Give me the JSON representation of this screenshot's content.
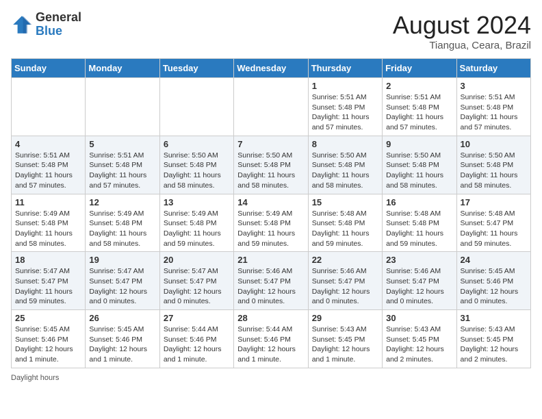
{
  "header": {
    "logo": {
      "line1": "General",
      "line2": "Blue"
    },
    "title": "August 2024",
    "location": "Tiangua, Ceara, Brazil"
  },
  "days_of_week": [
    "Sunday",
    "Monday",
    "Tuesday",
    "Wednesday",
    "Thursday",
    "Friday",
    "Saturday"
  ],
  "weeks": [
    [
      {
        "day": "",
        "info": ""
      },
      {
        "day": "",
        "info": ""
      },
      {
        "day": "",
        "info": ""
      },
      {
        "day": "",
        "info": ""
      },
      {
        "day": "1",
        "info": "Sunrise: 5:51 AM\nSunset: 5:48 PM\nDaylight: 11 hours and 57 minutes."
      },
      {
        "day": "2",
        "info": "Sunrise: 5:51 AM\nSunset: 5:48 PM\nDaylight: 11 hours and 57 minutes."
      },
      {
        "day": "3",
        "info": "Sunrise: 5:51 AM\nSunset: 5:48 PM\nDaylight: 11 hours and 57 minutes."
      }
    ],
    [
      {
        "day": "4",
        "info": "Sunrise: 5:51 AM\nSunset: 5:48 PM\nDaylight: 11 hours and 57 minutes."
      },
      {
        "day": "5",
        "info": "Sunrise: 5:51 AM\nSunset: 5:48 PM\nDaylight: 11 hours and 57 minutes."
      },
      {
        "day": "6",
        "info": "Sunrise: 5:50 AM\nSunset: 5:48 PM\nDaylight: 11 hours and 58 minutes."
      },
      {
        "day": "7",
        "info": "Sunrise: 5:50 AM\nSunset: 5:48 PM\nDaylight: 11 hours and 58 minutes."
      },
      {
        "day": "8",
        "info": "Sunrise: 5:50 AM\nSunset: 5:48 PM\nDaylight: 11 hours and 58 minutes."
      },
      {
        "day": "9",
        "info": "Sunrise: 5:50 AM\nSunset: 5:48 PM\nDaylight: 11 hours and 58 minutes."
      },
      {
        "day": "10",
        "info": "Sunrise: 5:50 AM\nSunset: 5:48 PM\nDaylight: 11 hours and 58 minutes."
      }
    ],
    [
      {
        "day": "11",
        "info": "Sunrise: 5:49 AM\nSunset: 5:48 PM\nDaylight: 11 hours and 58 minutes."
      },
      {
        "day": "12",
        "info": "Sunrise: 5:49 AM\nSunset: 5:48 PM\nDaylight: 11 hours and 58 minutes."
      },
      {
        "day": "13",
        "info": "Sunrise: 5:49 AM\nSunset: 5:48 PM\nDaylight: 11 hours and 59 minutes."
      },
      {
        "day": "14",
        "info": "Sunrise: 5:49 AM\nSunset: 5:48 PM\nDaylight: 11 hours and 59 minutes."
      },
      {
        "day": "15",
        "info": "Sunrise: 5:48 AM\nSunset: 5:48 PM\nDaylight: 11 hours and 59 minutes."
      },
      {
        "day": "16",
        "info": "Sunrise: 5:48 AM\nSunset: 5:48 PM\nDaylight: 11 hours and 59 minutes."
      },
      {
        "day": "17",
        "info": "Sunrise: 5:48 AM\nSunset: 5:47 PM\nDaylight: 11 hours and 59 minutes."
      }
    ],
    [
      {
        "day": "18",
        "info": "Sunrise: 5:47 AM\nSunset: 5:47 PM\nDaylight: 11 hours and 59 minutes."
      },
      {
        "day": "19",
        "info": "Sunrise: 5:47 AM\nSunset: 5:47 PM\nDaylight: 12 hours and 0 minutes."
      },
      {
        "day": "20",
        "info": "Sunrise: 5:47 AM\nSunset: 5:47 PM\nDaylight: 12 hours and 0 minutes."
      },
      {
        "day": "21",
        "info": "Sunrise: 5:46 AM\nSunset: 5:47 PM\nDaylight: 12 hours and 0 minutes."
      },
      {
        "day": "22",
        "info": "Sunrise: 5:46 AM\nSunset: 5:47 PM\nDaylight: 12 hours and 0 minutes."
      },
      {
        "day": "23",
        "info": "Sunrise: 5:46 AM\nSunset: 5:47 PM\nDaylight: 12 hours and 0 minutes."
      },
      {
        "day": "24",
        "info": "Sunrise: 5:45 AM\nSunset: 5:46 PM\nDaylight: 12 hours and 0 minutes."
      }
    ],
    [
      {
        "day": "25",
        "info": "Sunrise: 5:45 AM\nSunset: 5:46 PM\nDaylight: 12 hours and 1 minute."
      },
      {
        "day": "26",
        "info": "Sunrise: 5:45 AM\nSunset: 5:46 PM\nDaylight: 12 hours and 1 minute."
      },
      {
        "day": "27",
        "info": "Sunrise: 5:44 AM\nSunset: 5:46 PM\nDaylight: 12 hours and 1 minute."
      },
      {
        "day": "28",
        "info": "Sunrise: 5:44 AM\nSunset: 5:46 PM\nDaylight: 12 hours and 1 minute."
      },
      {
        "day": "29",
        "info": "Sunrise: 5:43 AM\nSunset: 5:45 PM\nDaylight: 12 hours and 1 minute."
      },
      {
        "day": "30",
        "info": "Sunrise: 5:43 AM\nSunset: 5:45 PM\nDaylight: 12 hours and 2 minutes."
      },
      {
        "day": "31",
        "info": "Sunrise: 5:43 AM\nSunset: 5:45 PM\nDaylight: 12 hours and 2 minutes."
      }
    ]
  ],
  "footer": {
    "daylight_label": "Daylight hours"
  }
}
